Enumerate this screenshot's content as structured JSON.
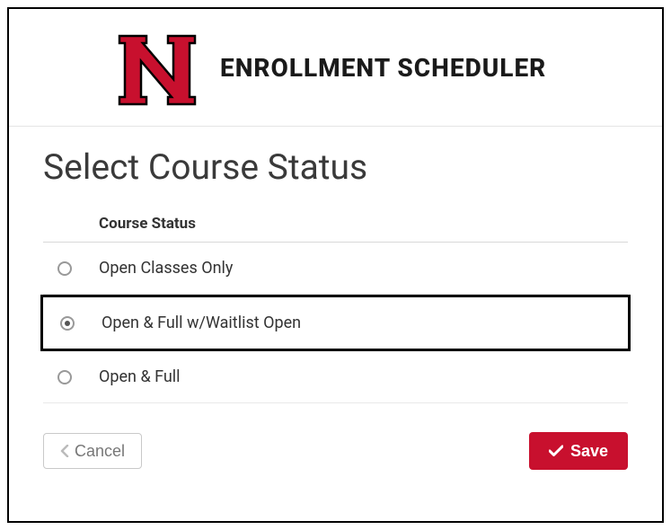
{
  "header": {
    "app_title": "ENROLLMENT SCHEDULER"
  },
  "main": {
    "page_title": "Select Course Status",
    "table": {
      "column_header": "Course Status",
      "options": [
        {
          "label": "Open Classes Only",
          "selected": false,
          "highlighted": false
        },
        {
          "label": "Open & Full w/Waitlist Open",
          "selected": true,
          "highlighted": true
        },
        {
          "label": "Open & Full",
          "selected": false,
          "highlighted": false
        }
      ]
    },
    "actions": {
      "cancel_label": "Cancel",
      "save_label": "Save"
    }
  },
  "colors": {
    "brand_red": "#c8102e"
  }
}
